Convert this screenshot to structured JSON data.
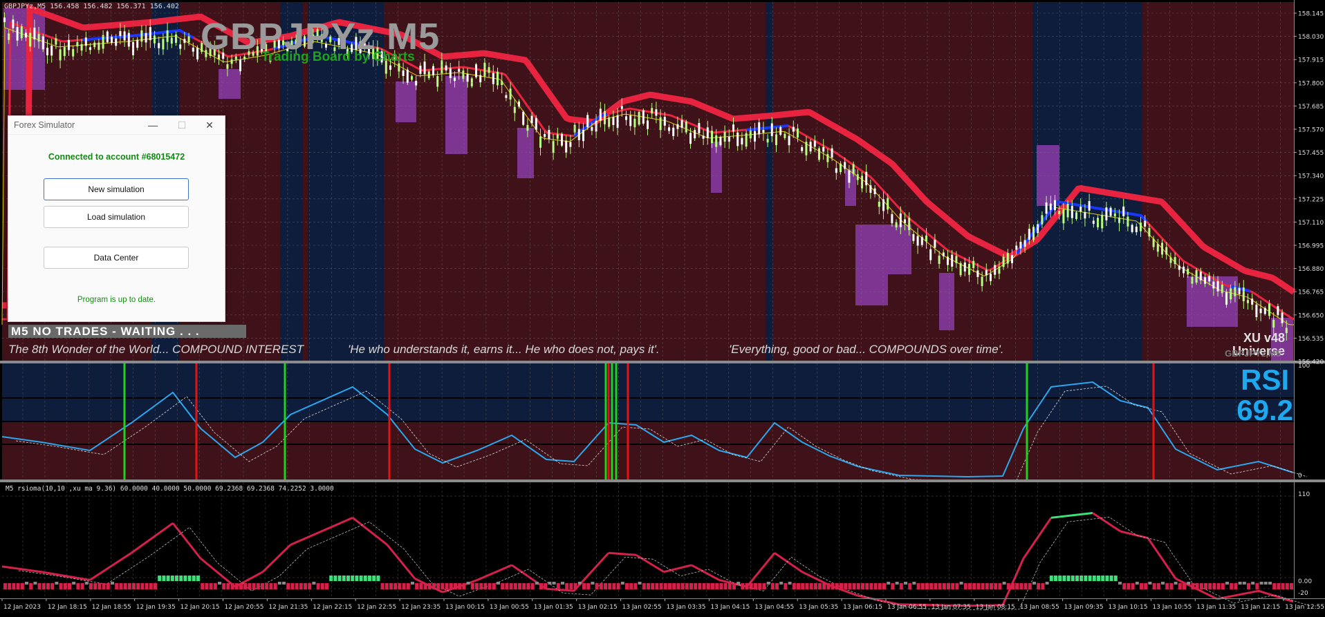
{
  "header": {
    "symbol_info": "GBPJPYz,M5  156.458 156.482 156.371 156.402",
    "big_title": "GBPJPYz M5",
    "sub_title": "Trading Board by Charts"
  },
  "status": {
    "trades": "M5  NO TRADES - WAITING . . ."
  },
  "quotes": [
    "The 8th Wonder of the World... COMPOUND INTEREST",
    "'He who understands it, earns it... He who does not, pays it'.",
    "'Everything, good or bad... COMPOUNDS over time'."
  ],
  "badge": {
    "version": "XU v48",
    "name": "Universe",
    "symbol": "GBPJPYz,M5"
  },
  "rsi": {
    "label": "RSI",
    "value": "69.2"
  },
  "sub_indicator": {
    "header": "M5  rsioma(10,10 ,xu ma 9.36) 60.0000 40.0000 50.0000 69.2368 69.2368 74.2252 3.0000"
  },
  "simulator": {
    "title": "Forex Simulator",
    "connected": "Connected to account #68015472",
    "new_simulation": "New simulation",
    "load_simulation": "Load simulation",
    "data_center": "Data Center",
    "up_to_date": "Program is up to date.",
    "minimize_icon": "—",
    "maximize_icon": "☐",
    "close_icon": "✕"
  },
  "colors": {
    "bear_zone": "#3f1219",
    "bull_zone": "#0f1d3d",
    "ma_red": "#e8233f",
    "ma_blue": "#1a37ff",
    "candle": "#b7ff82",
    "box_purple": "#8a3ca8",
    "rsi_line": "#2aa8f0",
    "signal_green": "#22d11f",
    "signal_red": "#e01414",
    "rsioma_up": "#3ee07c",
    "rsioma_down": "#d6204a"
  },
  "price_axis": {
    "labels": [
      "158.145",
      "158.030",
      "157.915",
      "157.800",
      "157.685",
      "157.570",
      "157.455",
      "157.340",
      "157.225",
      "157.110",
      "156.995",
      "156.880",
      "156.765",
      "156.650",
      "156.535",
      "156.420"
    ]
  },
  "rsi_axis": {
    "labels": [
      "100",
      "0"
    ]
  },
  "sub_axis": {
    "labels": [
      "110",
      "0.00",
      "-20"
    ]
  },
  "time_axis": {
    "labels": [
      "12 Jan 2023",
      "12 Jan 18:15",
      "12 Jan 18:55",
      "12 Jan 19:35",
      "12 Jan 20:15",
      "12 Jan 20:55",
      "12 Jan 21:35",
      "12 Jan 22:15",
      "12 Jan 22:55",
      "12 Jan 23:35",
      "13 Jan 00:15",
      "13 Jan 00:55",
      "13 Jan 01:35",
      "13 Jan 02:15",
      "13 Jan 02:55",
      "13 Jan 03:35",
      "13 Jan 04:15",
      "13 Jan 04:55",
      "13 Jan 05:35",
      "13 Jan 06:15",
      "13 Jan 06:55",
      "13 Jan 07:35",
      "13 Jan 08:15",
      "13 Jan 08:55",
      "13 Jan 09:35",
      "13 Jan 10:15",
      "13 Jan 10:55",
      "13 Jan 11:35",
      "13 Jan 12:15",
      "13 Jan 12:55"
    ]
  }
}
